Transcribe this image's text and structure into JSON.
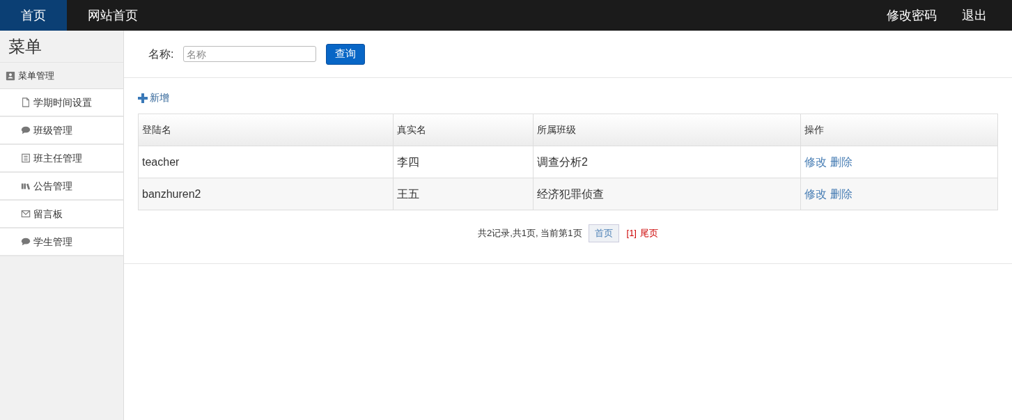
{
  "top_nav": {
    "left": [
      {
        "label": "首页",
        "selected": true
      },
      {
        "label": "网站首页",
        "selected": false
      }
    ],
    "right": [
      {
        "label": "修改密码"
      },
      {
        "label": "退出"
      }
    ]
  },
  "sidebar": {
    "title": "菜单",
    "group": {
      "label": "菜单管理",
      "children": [
        {
          "label": "学期时间设置"
        },
        {
          "label": "班级管理"
        },
        {
          "label": "班主任管理"
        },
        {
          "label": "公告管理"
        },
        {
          "label": "留言板"
        },
        {
          "label": "学生管理"
        }
      ]
    }
  },
  "search": {
    "label": "名称:",
    "placeholder": "名称",
    "button": "查询"
  },
  "add_link": "新增",
  "table": {
    "columns": [
      "登陆名",
      "真实名",
      "所属班级",
      "操作"
    ],
    "rows": [
      {
        "cells": [
          "teacher",
          "李四",
          "调查分析2"
        ],
        "actions": [
          "修改",
          "删除"
        ]
      },
      {
        "cells": [
          "banzhuren2",
          "王五",
          "经济犯罪侦查"
        ],
        "actions": [
          "修改",
          "删除"
        ]
      }
    ]
  },
  "pagination": {
    "summary": "共2记录,共1页, 当前第1页",
    "first": "首页",
    "pages": [
      {
        "label": "[1]",
        "selected": true
      }
    ],
    "last": "尾页"
  }
}
